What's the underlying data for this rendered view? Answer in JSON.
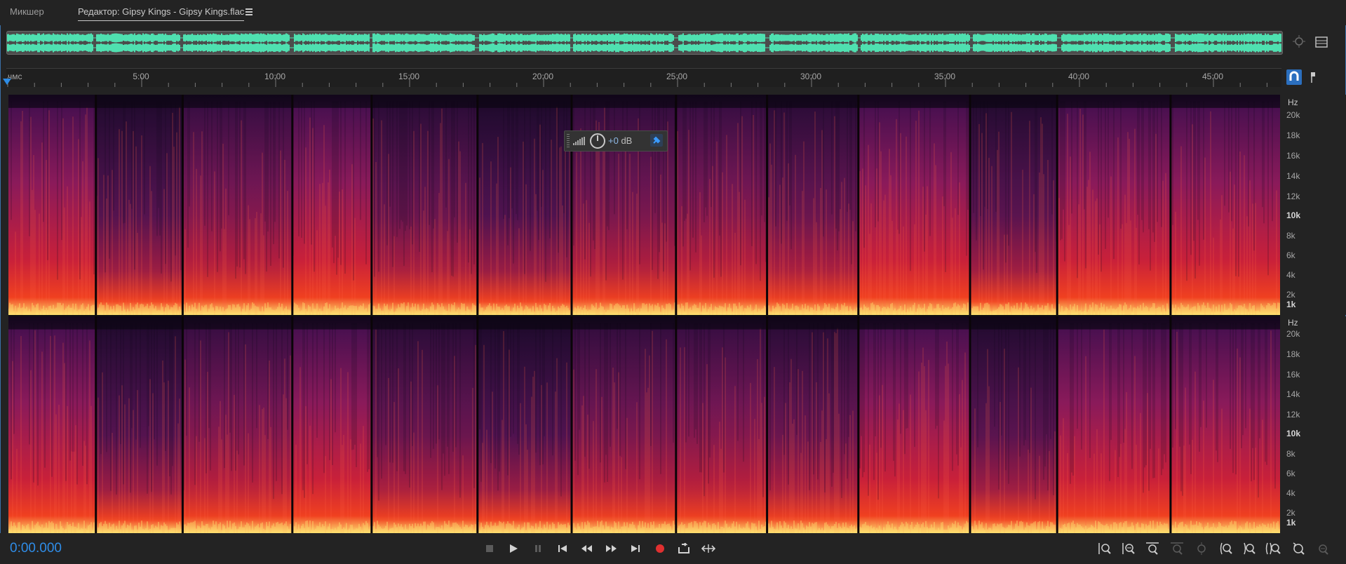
{
  "tabs": [
    {
      "label": "Микшер",
      "active": false
    },
    {
      "label": "Редактор: Gipsy Kings - Gipsy Kings.flac",
      "active": true
    }
  ],
  "editor_menu_icon": "hamburger-menu-icon",
  "overview": {
    "waveform_color": "#4fe0b0",
    "icons": [
      "zoom-to-selection-icon",
      "panel-menu-icon"
    ]
  },
  "ruler": {
    "unit_label": "чмс",
    "tick_labels": [
      "5:00",
      "10:00",
      "15:00",
      "20:00",
      "25:00",
      "30:00",
      "35:00",
      "40:00",
      "45:00"
    ],
    "icons": [
      "snap-magnet-icon",
      "marker-pin-icon"
    ]
  },
  "frequency_axis": {
    "unit_label": "Hz",
    "labels": [
      "20k",
      "18k",
      "16k",
      "14k",
      "12k",
      "10k",
      "8k",
      "6k",
      "4k",
      "2k",
      "1k"
    ],
    "bold": [
      "10k",
      "1k"
    ]
  },
  "channels": [
    "left",
    "right"
  ],
  "track_boundaries_fraction": [
    0.0688,
    0.137,
    0.2233,
    0.2856,
    0.3689,
    0.4429,
    0.525,
    0.5966,
    0.6684,
    0.7562,
    0.8247,
    0.9139
  ],
  "hud": {
    "value": "+0",
    "unit": "dB",
    "icons": [
      "level-meter-icon",
      "volume-knob-icon",
      "pin-icon"
    ]
  },
  "transport": {
    "timecode": "0:00.000",
    "buttons": [
      "stop-icon",
      "play-icon",
      "pause-icon",
      "go-to-start-icon",
      "rewind-icon",
      "fast-forward-icon",
      "go-to-end-icon",
      "record-icon",
      "loop-icon",
      "skip-selection-icon"
    ],
    "record_color": "#e03030",
    "zoom_buttons": [
      "zoom-in-amplitude-icon",
      "zoom-out-amplitude-icon",
      "zoom-in-time-icon",
      "zoom-out-full-icon",
      "zoom-selection-icon",
      "zoom-in-left-icon",
      "zoom-in-right-icon",
      "zoom-full-icon",
      "zoom-reset-icon",
      "zoom-out-all-icon"
    ]
  },
  "colors": {
    "accent": "#2f8de8",
    "spectrogram_low": "#1a0a2a",
    "spectrogram_mid": "#8a1a5a",
    "spectrogram_high": "#f04020",
    "spectrogram_peak": "#ffe070"
  }
}
